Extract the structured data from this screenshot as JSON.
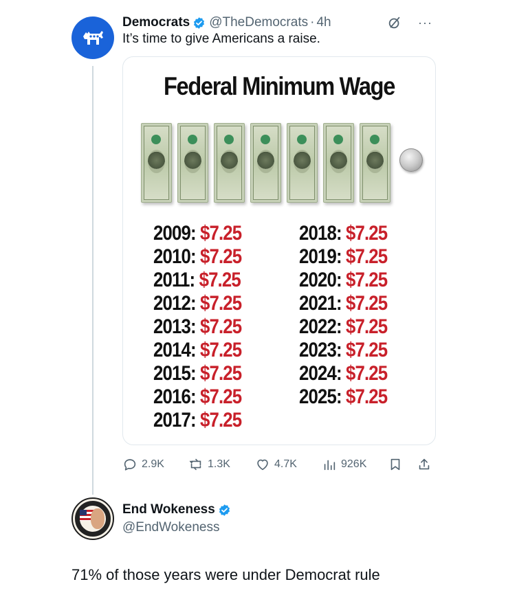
{
  "tweet": {
    "author_name": "Democrats",
    "author_handle": "@TheDemocrats",
    "separator": "·",
    "time": "4h",
    "text": "It’s time to give Americans a raise.",
    "icons": {
      "avatar": "democratic-donkey-logo",
      "verified": "verified-badge",
      "grok": "grok-icon",
      "more": "more-icon"
    },
    "more_glyph": "···",
    "image": {
      "title": "Federal Minimum Wage",
      "bill_count": 7,
      "coin_count": 1,
      "left_column": [
        {
          "year": "2009:",
          "amount": "$7.25"
        },
        {
          "year": "2010:",
          "amount": "$7.25"
        },
        {
          "year": "2011:",
          "amount": "$7.25"
        },
        {
          "year": "2012:",
          "amount": "$7.25"
        },
        {
          "year": "2013:",
          "amount": "$7.25"
        },
        {
          "year": "2014:",
          "amount": "$7.25"
        },
        {
          "year": "2015:",
          "amount": "$7.25"
        },
        {
          "year": "2016:",
          "amount": "$7.25"
        },
        {
          "year": "2017:",
          "amount": "$7.25"
        }
      ],
      "right_column": [
        {
          "year": "2018:",
          "amount": "$7.25"
        },
        {
          "year": "2019:",
          "amount": "$7.25"
        },
        {
          "year": "2020:",
          "amount": "$7.25"
        },
        {
          "year": "2021:",
          "amount": "$7.25"
        },
        {
          "year": "2022:",
          "amount": "$7.25"
        },
        {
          "year": "2023:",
          "amount": "$7.25"
        },
        {
          "year": "2024:",
          "amount": "$7.25"
        },
        {
          "year": "2025:",
          "amount": "$7.25"
        }
      ]
    },
    "actions": {
      "replies": "2.9K",
      "reposts": "1.3K",
      "likes": "4.7K",
      "views": "926K"
    }
  },
  "reply": {
    "author_name": "End Wokeness",
    "author_handle": "@EndWokeness",
    "text": "71% of those years were under Democrat rule",
    "icons": {
      "avatar": "profile-avatar",
      "verified": "verified-badge"
    }
  },
  "colors": {
    "accent_blue": "#1d9bf0",
    "wage_red": "#c8202a",
    "muted_text": "#536471",
    "dem_blue": "#1a63d9"
  }
}
